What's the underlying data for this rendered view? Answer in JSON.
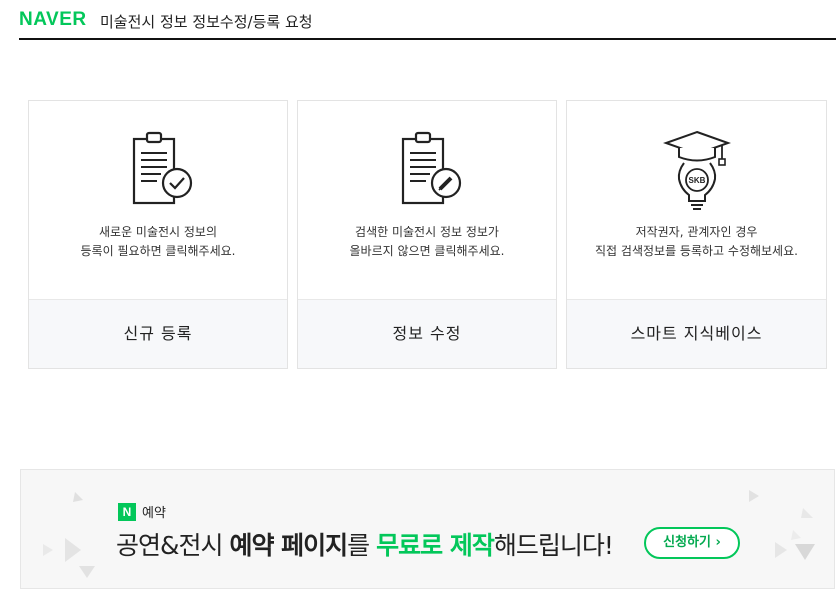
{
  "header": {
    "logo": "NAVER",
    "title": "미술전시 정보 정보수정/등록 요청"
  },
  "cards": [
    {
      "id": "new",
      "icon": "clipboard-check-icon",
      "desc_lines": [
        "새로운 미술전시 정보의",
        "등록이 필요하면 클릭해주세요."
      ],
      "action": "신규 등록"
    },
    {
      "id": "edit",
      "icon": "clipboard-edit-icon",
      "desc_lines": [
        "검색한 미술전시 정보 정보가",
        "올바르지 않으면 클릭해주세요."
      ],
      "action": "정보 수정"
    },
    {
      "id": "skb",
      "icon": "graduation-bulb-icon",
      "icon_text": "SKB",
      "desc_lines": [
        "저작권자, 관계자인 경우",
        "직접 검색정보를 등록하고 수정해보세요."
      ],
      "action": "스마트 지식베이스"
    }
  ],
  "banner": {
    "badge": "N",
    "badge_label": "예약",
    "text_prefix": "공연&전시 ",
    "text_bold": "예약 페이지",
    "text_mid": "를 ",
    "text_green": "무료로 제작",
    "text_suffix": "해드립니다!",
    "button_label": "신청하기",
    "button_chevron": "›"
  },
  "colors": {
    "brand": "#03c75a",
    "text": "#222222",
    "card_footer_bg": "#f7f8fa",
    "banner_bg": "#f7f7f7"
  }
}
